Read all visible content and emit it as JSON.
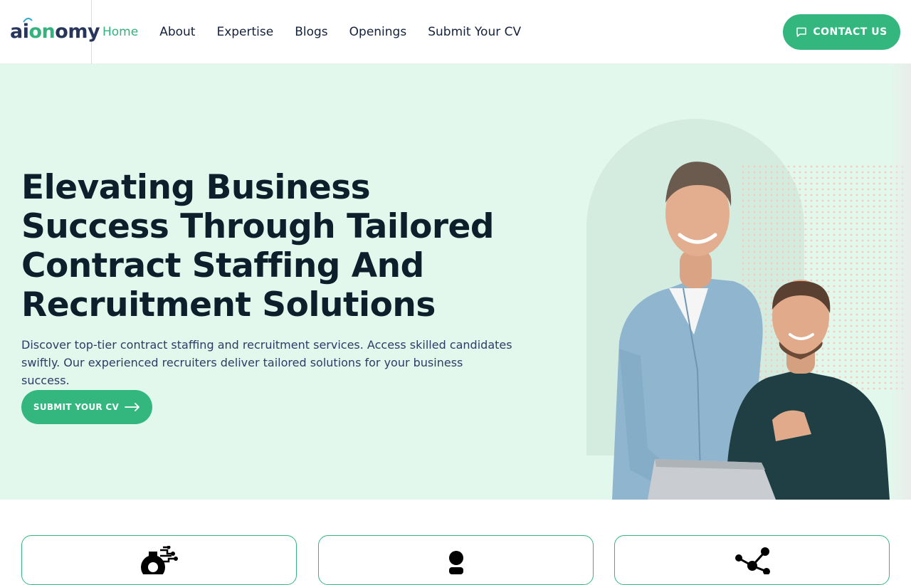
{
  "brand": {
    "logo_prefix": "ai",
    "logo_mid": "on",
    "logo_suffix": "omy"
  },
  "nav": {
    "items": [
      {
        "label": "Home",
        "active": true
      },
      {
        "label": "About"
      },
      {
        "label": "Expertise"
      },
      {
        "label": "Blogs"
      },
      {
        "label": "Openings"
      },
      {
        "label": "Submit Your CV"
      }
    ],
    "contact_label": "CONTACT US",
    "contact_icon": "chat-icon"
  },
  "hero": {
    "title": "Elevating Business Success Through Tailored Contract Staffing And Recruitment Solutions",
    "description": "Discover top-tier contract staffing and recruitment services. Access skilled candidates swiftly. Our experienced recruiters deliver tailored solutions for your business success.",
    "cta_label": "SUBMIT YOUR CV",
    "cta_icon": "arrow-right-icon",
    "image": "two-smiling-men-at-laptop"
  },
  "cards": [
    {
      "icon": "gear-circuit-icon"
    },
    {
      "icon": "person-icon"
    },
    {
      "icon": "network-icon"
    }
  ],
  "colors": {
    "accent": "#33b77f",
    "hero_bg": "#e2f8ec",
    "heading": "#0e1f2c",
    "nav_text": "#14213d"
  }
}
